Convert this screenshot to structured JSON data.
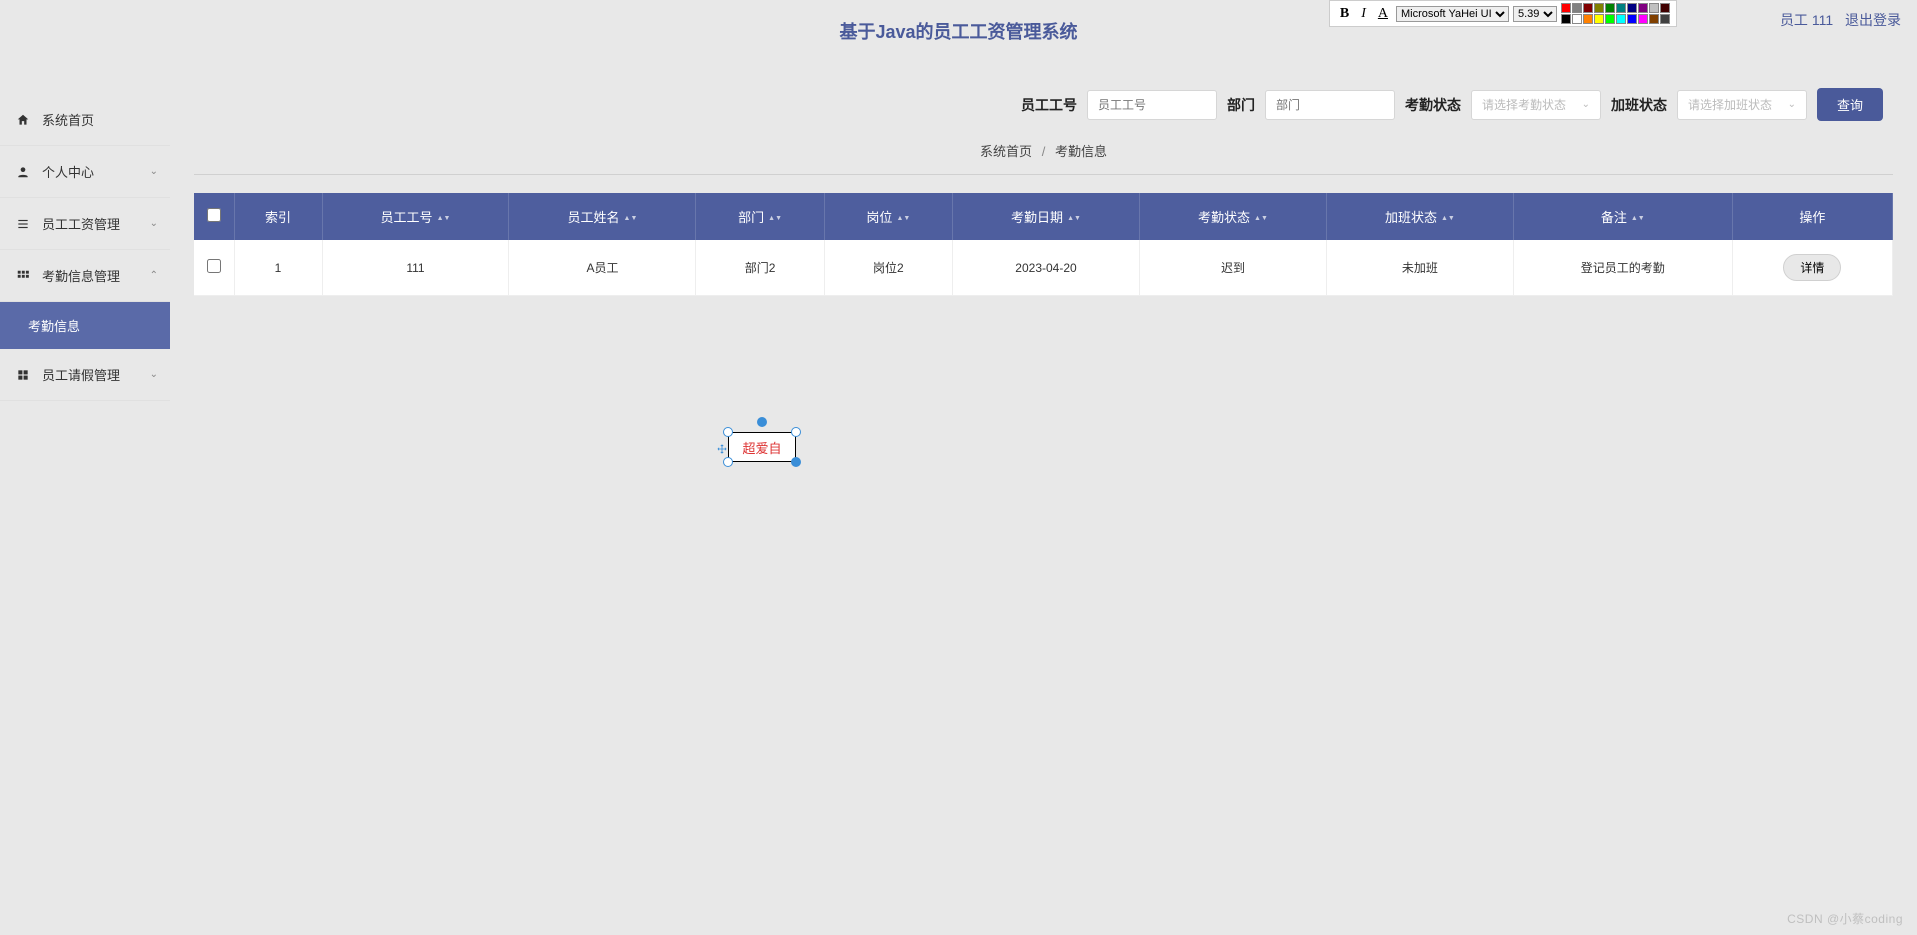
{
  "header": {
    "title": "基于Java的员工工资管理系统"
  },
  "user": {
    "role_label": "员工 111",
    "logout": "退出登录"
  },
  "editor": {
    "bold": "B",
    "italic": "I",
    "font_color_btn": "A",
    "font_family": "Microsoft YaHei UI",
    "font_size": "5.39"
  },
  "sidebar": {
    "items": [
      {
        "label": "系统首页",
        "icon": "home",
        "expandable": false
      },
      {
        "label": "个人中心",
        "icon": "person",
        "expandable": true
      },
      {
        "label": "员工工资管理",
        "icon": "list",
        "expandable": true
      },
      {
        "label": "考勤信息管理",
        "icon": "grid",
        "expandable": true,
        "open": true,
        "children": [
          {
            "label": "考勤信息"
          }
        ]
      },
      {
        "label": "员工请假管理",
        "icon": "apps",
        "expandable": true
      }
    ]
  },
  "search": {
    "emp_id_label": "员工工号",
    "emp_id_placeholder": "员工工号",
    "dept_label": "部门",
    "dept_placeholder": "部门",
    "attend_label": "考勤状态",
    "attend_placeholder": "请选择考勤状态",
    "overtime_label": "加班状态",
    "overtime_placeholder": "请选择加班状态",
    "button": "查询"
  },
  "breadcrumb": {
    "home": "系统首页",
    "current": "考勤信息"
  },
  "table": {
    "headers": {
      "index": "索引",
      "emp_id": "员工工号",
      "emp_name": "员工姓名",
      "dept": "部门",
      "post": "岗位",
      "date": "考勤日期",
      "attend": "考勤状态",
      "overtime": "加班状态",
      "remark": "备注",
      "action": "操作"
    },
    "rows": [
      {
        "index": "1",
        "emp_id": "111",
        "emp_name": "A员工",
        "dept": "部门2",
        "post": "岗位2",
        "date": "2023-04-20",
        "attend": "迟到",
        "overtime": "未加班",
        "remark": "登记员工的考勤",
        "action": "详情"
      }
    ]
  },
  "annotation": {
    "text": "超爱自"
  },
  "watermark": "CSDN @小蔡coding",
  "colors": {
    "accent": "#4a5a9a",
    "palette": [
      "#ff0000",
      "#808080",
      "#800000",
      "#808000",
      "#008000",
      "#008080",
      "#000080",
      "#800080",
      "#c0c0c0",
      "#400000",
      "#000000",
      "#ffffff",
      "#ff8000",
      "#ffff00",
      "#00ff00",
      "#00ffff",
      "#0000ff",
      "#ff00ff",
      "#804000",
      "#404040"
    ]
  }
}
